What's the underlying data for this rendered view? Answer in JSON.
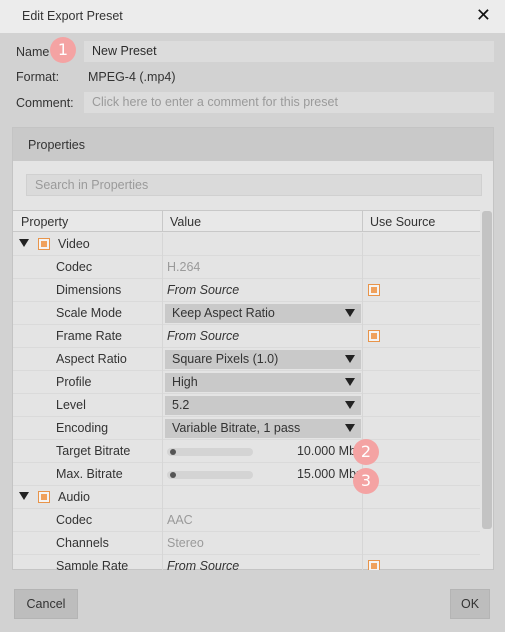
{
  "window": {
    "title": "Edit Export Preset"
  },
  "form": {
    "name_label": "Name",
    "name_value": "New Preset",
    "format_label": "Format:",
    "format_value": "MPEG-4 (.mp4)",
    "comment_label": "Comment:",
    "comment_placeholder": "Click here to enter a comment for this preset"
  },
  "properties": {
    "header": "Properties",
    "search_placeholder": "Search in Properties",
    "columns": [
      "Property",
      "Value",
      "Use Source"
    ],
    "groups": [
      {
        "name": "Video",
        "checked": true,
        "rows": [
          {
            "label": "Codec",
            "value": "H.264",
            "kind": "readonly"
          },
          {
            "label": "Dimensions",
            "value": "From Source",
            "kind": "italic",
            "use_source": true
          },
          {
            "label": "Scale Mode",
            "value": "Keep Aspect Ratio",
            "kind": "select"
          },
          {
            "label": "Frame Rate",
            "value": "From Source",
            "kind": "italic",
            "use_source": true
          },
          {
            "label": "Aspect Ratio",
            "value": "Square Pixels (1.0)",
            "kind": "select"
          },
          {
            "label": "Profile",
            "value": "High",
            "kind": "select"
          },
          {
            "label": "Level",
            "value": "5.2",
            "kind": "select"
          },
          {
            "label": "Encoding",
            "value": "Variable Bitrate, 1 pass",
            "kind": "select"
          },
          {
            "label": "Target Bitrate",
            "value": "10.000 Mbp",
            "kind": "slider",
            "level": 0.02
          },
          {
            "label": "Max. Bitrate",
            "value": "15.000 Mbp",
            "kind": "slider",
            "level": 0.02
          }
        ]
      },
      {
        "name": "Audio",
        "checked": true,
        "rows": [
          {
            "label": "Codec",
            "value": "AAC",
            "kind": "readonly"
          },
          {
            "label": "Channels",
            "value": "Stereo",
            "kind": "readonly"
          },
          {
            "label": "Sample Rate",
            "value": "From Source",
            "kind": "italic",
            "use_source": true
          }
        ]
      }
    ]
  },
  "badges": [
    "1",
    "2",
    "3"
  ],
  "buttons": {
    "cancel": "Cancel",
    "ok": "OK"
  },
  "colors": {
    "accent_checkbox": "#f0a15c",
    "badge": "#f4a3a3"
  }
}
